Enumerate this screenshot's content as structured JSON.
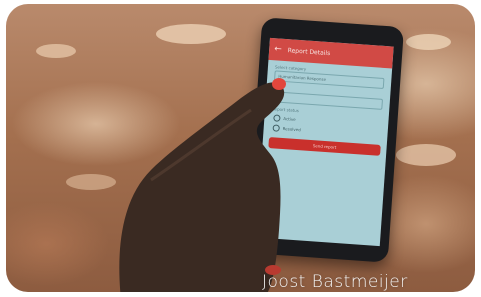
{
  "photo": {
    "credit": "Joost Bastmeijer"
  },
  "phone_screen": {
    "app_title": "Report Details",
    "field1_label": "Select category",
    "field1_value": "Humanitarian Response",
    "field2_label": "Date",
    "question_label": "Report status",
    "option1": "Active",
    "option2": "Resolved",
    "submit_label": "Send report"
  }
}
